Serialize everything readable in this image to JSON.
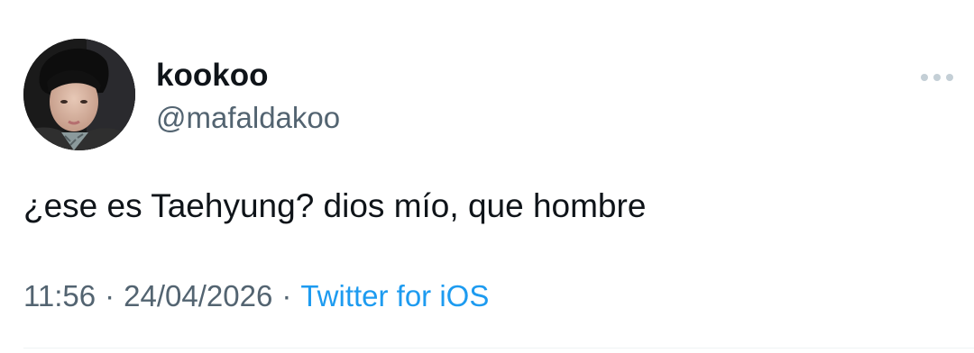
{
  "author": {
    "display_name": "kookoo",
    "handle": "@mafaldakoo",
    "avatar": "profile-photo"
  },
  "tweet": {
    "text": "¿ese es Taehyung? dios mío, que hombre"
  },
  "meta": {
    "time": "11:56",
    "separator_1": "·",
    "date": "24/04/2026",
    "separator_2": "·",
    "source": "Twitter for iOS"
  },
  "icons": {
    "more": "more-horizontal-icon"
  },
  "colors": {
    "text_primary": "#0f1419",
    "text_secondary": "#536471",
    "link_blue": "#1d9bf0",
    "divider": "#eff3f4",
    "more_icon": "#c4cfd6"
  }
}
